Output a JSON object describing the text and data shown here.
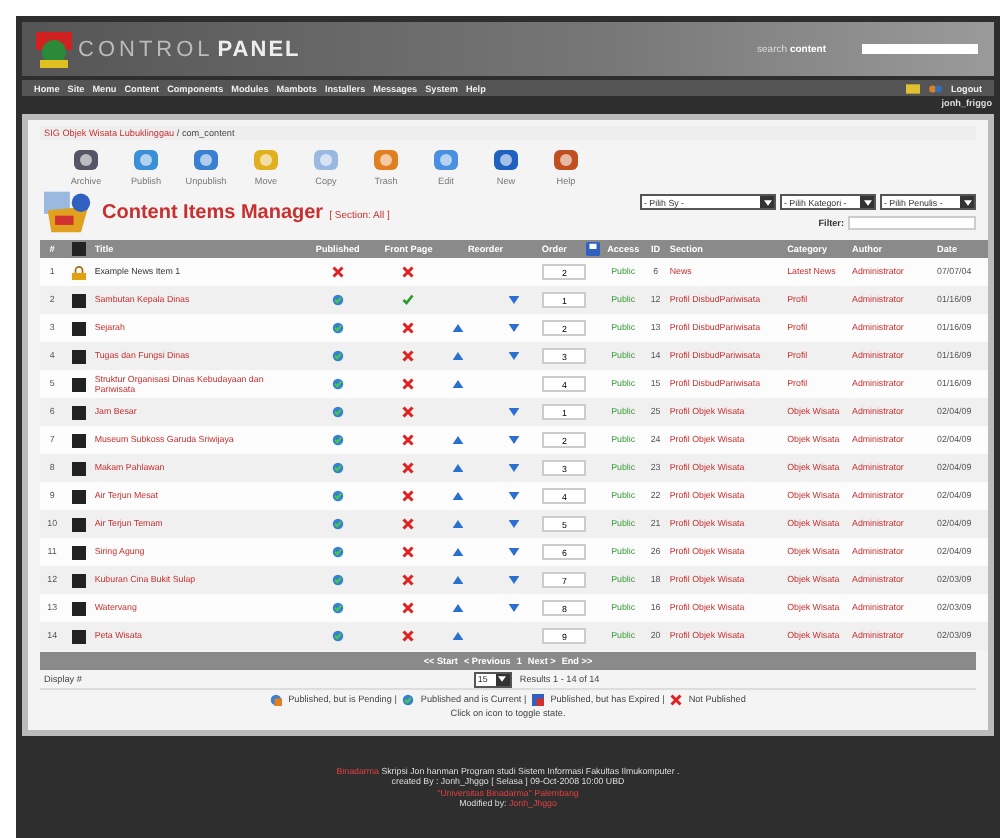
{
  "header": {
    "logo_light": "CONTROL",
    "logo_bold": "PANEL",
    "search_label": "search",
    "search_bold": "content"
  },
  "menu": [
    "Home",
    "Site",
    "Menu",
    "Content",
    "Components",
    "Modules",
    "Mambots",
    "Installers",
    "Messages",
    "System",
    "Help"
  ],
  "user": {
    "logout": "Logout",
    "name": "jonh_friggo"
  },
  "breadcrumb": {
    "site": "SIG Objek Wisata Lubuklinggau",
    "path": " / com_content"
  },
  "toolbar": [
    "Archive",
    "Publish",
    "Unpublish",
    "Move",
    "Copy",
    "Trash",
    "Edit",
    "New",
    "Help"
  ],
  "title": "Content Items Manager",
  "subtitle": "[ Section: All ]",
  "filters": [
    "- Pilih Sy -",
    "- Pilih Kategori -",
    "- Pilih Penulis -"
  ],
  "filter_label": "Filter:",
  "columns": [
    "#",
    "Title",
    "Published",
    "Front Page",
    "Reorder",
    "Order",
    "Access",
    "ID",
    "Section",
    "Category",
    "Author",
    "Date"
  ],
  "rows": [
    {
      "n": "1",
      "checked_out": true,
      "title": "Example News Item 1",
      "published": false,
      "front": false,
      "up": false,
      "down": false,
      "order": "2",
      "access": "Public",
      "id": "6",
      "section": "News",
      "category": "Latest News",
      "author": "Administrator",
      "date": "07/07/04"
    },
    {
      "n": "2",
      "checked_out": false,
      "title": "Sambutan Kepala Dinas",
      "published": true,
      "front": true,
      "up": false,
      "down": true,
      "order": "1",
      "access": "Public",
      "id": "12",
      "section": "Profil DisbudPariwisata",
      "category": "Profil",
      "author": "Administrator",
      "date": "01/16/09"
    },
    {
      "n": "3",
      "checked_out": false,
      "title": "Sejarah",
      "published": true,
      "front": false,
      "up": true,
      "down": true,
      "order": "2",
      "access": "Public",
      "id": "13",
      "section": "Profil DisbudPariwisata",
      "category": "Profil",
      "author": "Administrator",
      "date": "01/16/09"
    },
    {
      "n": "4",
      "checked_out": false,
      "title": "Tugas dan Fungsi Dinas",
      "published": true,
      "front": false,
      "up": true,
      "down": true,
      "order": "3",
      "access": "Public",
      "id": "14",
      "section": "Profil DisbudPariwisata",
      "category": "Profil",
      "author": "Administrator",
      "date": "01/16/09"
    },
    {
      "n": "5",
      "checked_out": false,
      "title": "Struktur Organisasi Dinas Kebudayaan dan Pariwisata",
      "published": true,
      "front": false,
      "up": true,
      "down": false,
      "order": "4",
      "access": "Public",
      "id": "15",
      "section": "Profil DisbudPariwisata",
      "category": "Profil",
      "author": "Administrator",
      "date": "01/16/09"
    },
    {
      "n": "6",
      "checked_out": false,
      "title": "Jam Besar",
      "published": true,
      "front": false,
      "up": false,
      "down": true,
      "order": "1",
      "access": "Public",
      "id": "25",
      "section": "Profil Objek Wisata",
      "category": "Objek Wisata",
      "author": "Administrator",
      "date": "02/04/09"
    },
    {
      "n": "7",
      "checked_out": false,
      "title": "Museum Subkoss Garuda Sriwijaya",
      "published": true,
      "front": false,
      "up": true,
      "down": true,
      "order": "2",
      "access": "Public",
      "id": "24",
      "section": "Profil Objek Wisata",
      "category": "Objek Wisata",
      "author": "Administrator",
      "date": "02/04/09"
    },
    {
      "n": "8",
      "checked_out": false,
      "title": "Makam Pahlawan",
      "published": true,
      "front": false,
      "up": true,
      "down": true,
      "order": "3",
      "access": "Public",
      "id": "23",
      "section": "Profil Objek Wisata",
      "category": "Objek Wisata",
      "author": "Administrator",
      "date": "02/04/09"
    },
    {
      "n": "9",
      "checked_out": false,
      "title": "Air Terjun Mesat",
      "published": true,
      "front": false,
      "up": true,
      "down": true,
      "order": "4",
      "access": "Public",
      "id": "22",
      "section": "Profil Objek Wisata",
      "category": "Objek Wisata",
      "author": "Administrator",
      "date": "02/04/09"
    },
    {
      "n": "10",
      "checked_out": false,
      "title": "Air Terjun Temam",
      "published": true,
      "front": false,
      "up": true,
      "down": true,
      "order": "5",
      "access": "Public",
      "id": "21",
      "section": "Profil Objek Wisata",
      "category": "Objek Wisata",
      "author": "Administrator",
      "date": "02/04/09"
    },
    {
      "n": "11",
      "checked_out": false,
      "title": "Siring Agung",
      "published": true,
      "front": false,
      "up": true,
      "down": true,
      "order": "6",
      "access": "Public",
      "id": "26",
      "section": "Profil Objek Wisata",
      "category": "Objek Wisata",
      "author": "Administrator",
      "date": "02/04/09"
    },
    {
      "n": "12",
      "checked_out": false,
      "title": "Kuburan Cina Bukit Sulap",
      "published": true,
      "front": false,
      "up": true,
      "down": true,
      "order": "7",
      "access": "Public",
      "id": "18",
      "section": "Profil Objek Wisata",
      "category": "Objek Wisata",
      "author": "Administrator",
      "date": "02/03/09"
    },
    {
      "n": "13",
      "checked_out": false,
      "title": "Watervang",
      "published": true,
      "front": false,
      "up": true,
      "down": true,
      "order": "8",
      "access": "Public",
      "id": "16",
      "section": "Profil Objek Wisata",
      "category": "Objek Wisata",
      "author": "Administrator",
      "date": "02/03/09"
    },
    {
      "n": "14",
      "checked_out": false,
      "title": "Peta Wisata",
      "published": true,
      "front": false,
      "up": true,
      "down": false,
      "order": "9",
      "access": "Public",
      "id": "20",
      "section": "Profil Objek Wisata",
      "category": "Objek Wisata",
      "author": "Administrator",
      "date": "02/03/09"
    }
  ],
  "pagination": [
    "<< Start",
    "< Previous",
    "1",
    "Next >",
    "End >>"
  ],
  "display": {
    "label": "Display #",
    "value": "15",
    "results": "Results 1 - 14 of 14"
  },
  "legend": [
    {
      "kind": "pending",
      "text": "Published, but is Pending |"
    },
    {
      "kind": "current",
      "text": "Published and is Current |"
    },
    {
      "kind": "expired",
      "text": "Published, but has Expired |"
    },
    {
      "kind": "not",
      "text": "Not Published"
    }
  ],
  "hint": "Click on icon to toggle state.",
  "footer": {
    "brand": "Binadarma",
    "line1": "Skripsi Jon hanman Program studi Sistem Informasi Fakultas Ilmukomputer .",
    "line2": "created By : Jonh_Jhggo [ Selasa ] 09-Oct-2008 10:00 UBD",
    "line3": "\"Universitas Binadarma\" Palembang",
    "line4_label": "Modified by:",
    "line4_name": "Jonh_Jhggo"
  }
}
